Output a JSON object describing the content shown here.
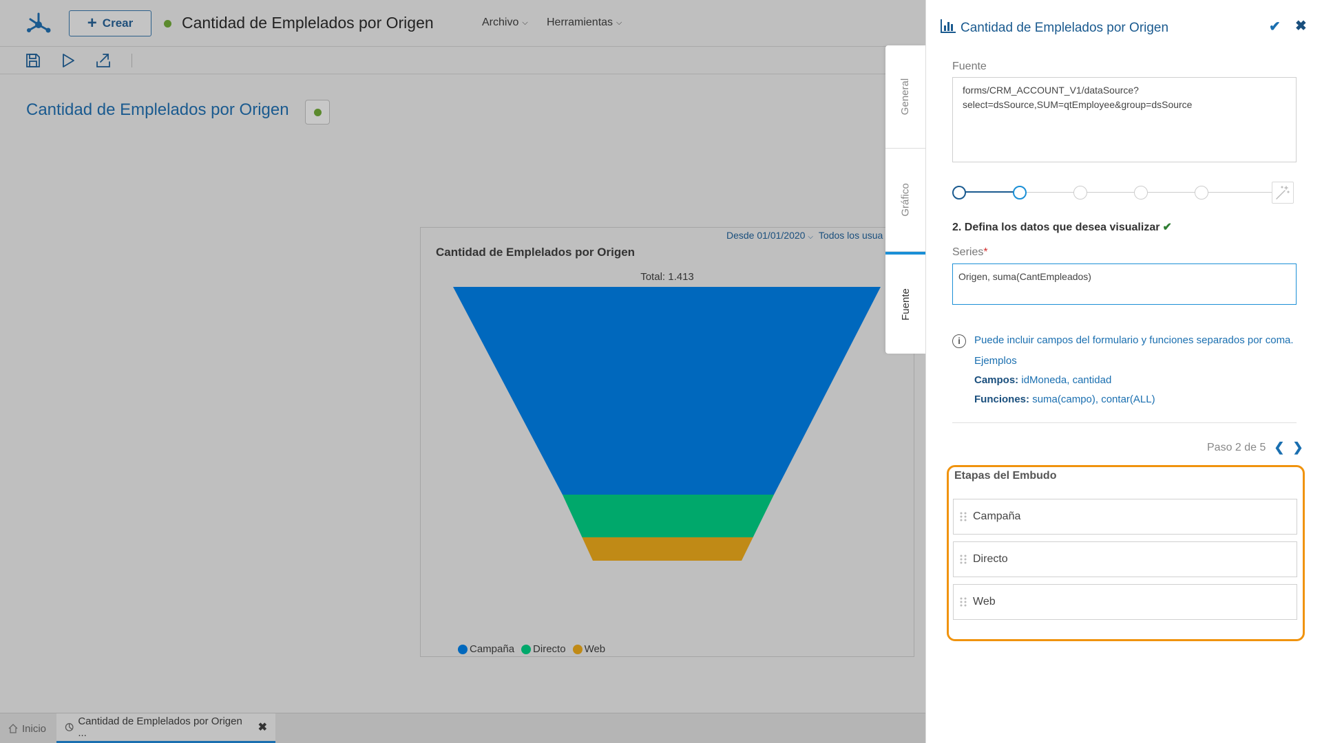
{
  "app": {
    "crear_label": "Crear",
    "title": "Cantidad de Emplelados por Origen",
    "menus": [
      "Archivo",
      "Herramientas"
    ],
    "status_color": "#5c8a2e"
  },
  "page": {
    "title": "Cantidad de Emplelados por Origen"
  },
  "chart": {
    "filter_date": "Desde 01/01/2020",
    "filter_users": "Todos los usua"
  },
  "chart_data": {
    "type": "funnel",
    "title": "Cantidad de Emplelados por Origen",
    "total_label": "Total: 1.413",
    "categories": [
      "Campaña",
      "Directo",
      "Web"
    ],
    "colors": [
      "#0068bd",
      "#00a86b",
      "#c08a16"
    ],
    "legend_position": "bottom-left"
  },
  "bottom_tabs": {
    "home": "Inicio",
    "active": "Cantidad de Emplelados por Origen ..."
  },
  "side_tabs": [
    "General",
    "Gráfico",
    "Fuente"
  ],
  "panel": {
    "title": "Cantidad de Emplelados por Origen",
    "source_label": "Fuente",
    "source_value": "forms/CRM_ACCOUNT_V1/dataSource?\nselect=dsSource,SUM=qtEmployee&group=dsSource",
    "step_heading": "2. Defina los datos que desea visualizar",
    "series_label": "Series",
    "series_value": "Origen, suma(CantEmpleados)",
    "info_text": "Puede incluir campos del formulario y funciones separados por coma.",
    "examples_label": "Ejemplos",
    "fields_label": "Campos:",
    "fields_value": "idMoneda, cantidad",
    "functions_label": "Funciones:",
    "functions_value": "suma(campo), contar(ALL)",
    "step_counter": "Paso 2 de 5",
    "current_step": 2,
    "total_steps": 5,
    "stages_title": "Etapas del Embudo",
    "stages": [
      "Campaña",
      "Directo",
      "Web"
    ]
  }
}
